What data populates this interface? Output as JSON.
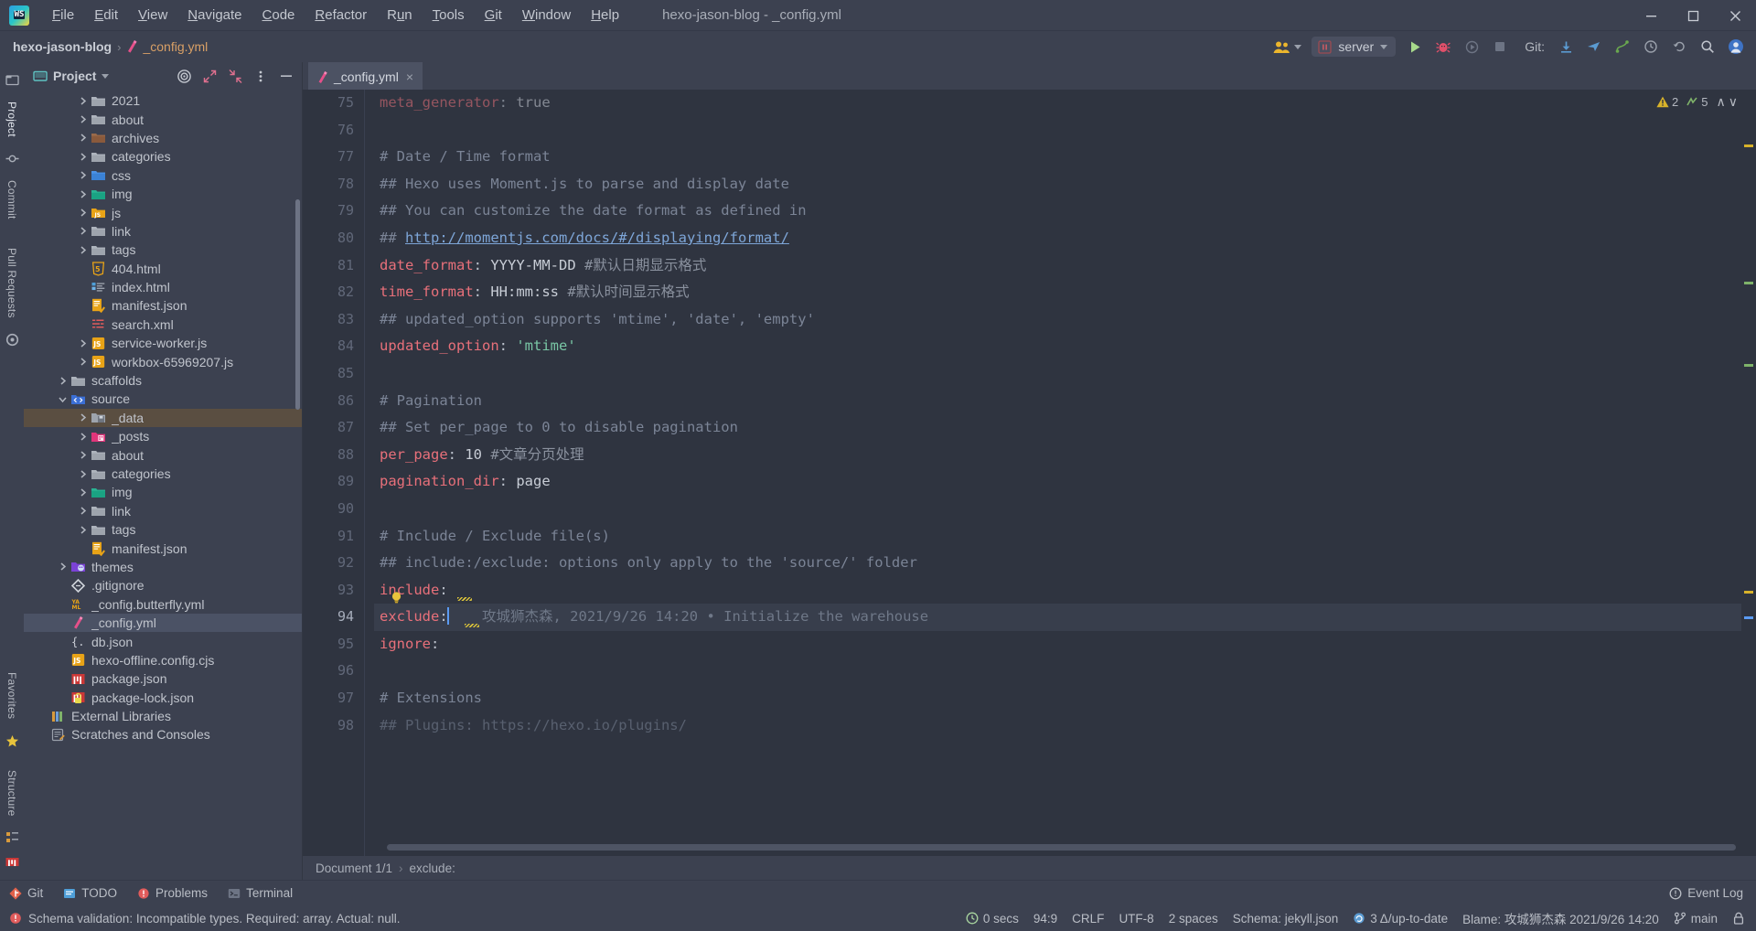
{
  "window": {
    "title": "hexo-jason-blog - _config.yml",
    "minimize_label": "—",
    "maximize_label": "❐",
    "close_label": "✕"
  },
  "menu": {
    "items": [
      {
        "label": "File",
        "mnemonic": "F"
      },
      {
        "label": "Edit",
        "mnemonic": "E"
      },
      {
        "label": "View",
        "mnemonic": "V"
      },
      {
        "label": "Navigate",
        "mnemonic": "N"
      },
      {
        "label": "Code",
        "mnemonic": "C"
      },
      {
        "label": "Refactor",
        "mnemonic": "R"
      },
      {
        "label": "Run",
        "mnemonic": "u"
      },
      {
        "label": "Tools",
        "mnemonic": "T"
      },
      {
        "label": "Git",
        "mnemonic": "G"
      },
      {
        "label": "Window",
        "mnemonic": "W"
      },
      {
        "label": "Help",
        "mnemonic": "H"
      }
    ]
  },
  "navbar": {
    "project_name": "hexo-jason-blog",
    "separator": "›",
    "file_name": "_config.yml",
    "run_config": "server",
    "git_label": "Git:",
    "icons": {
      "collab": "collab-users-icon",
      "run": "run-icon",
      "debug": "debug-icon",
      "run_with_coverage": "run-with-coverage-icon",
      "stop": "stop-icon",
      "update_project": "update-project-icon",
      "push": "push-icon",
      "branches": "git-branches-icon",
      "history": "history-icon",
      "rollback": "rollback-icon",
      "search": "search-everywhere-icon",
      "account": "account-icon"
    }
  },
  "left_strip": {
    "top": [
      "Project",
      "Commit",
      "Pull Requests"
    ],
    "bottom": [
      "Structure",
      "Favorites"
    ]
  },
  "project_panel": {
    "title": "Project",
    "tree": [
      {
        "label": "2021",
        "indent": 2,
        "arrow": "right",
        "icon": "folder",
        "clipped": true
      },
      {
        "label": "about",
        "indent": 2,
        "arrow": "right",
        "icon": "folder"
      },
      {
        "label": "archives",
        "indent": 2,
        "arrow": "right",
        "icon": "folder-archive"
      },
      {
        "label": "categories",
        "indent": 2,
        "arrow": "right",
        "icon": "folder"
      },
      {
        "label": "css",
        "indent": 2,
        "arrow": "right",
        "icon": "folder-css"
      },
      {
        "label": "img",
        "indent": 2,
        "arrow": "right",
        "icon": "folder-img"
      },
      {
        "label": "js",
        "indent": 2,
        "arrow": "right",
        "icon": "folder-js"
      },
      {
        "label": "link",
        "indent": 2,
        "arrow": "right",
        "icon": "folder"
      },
      {
        "label": "tags",
        "indent": 2,
        "arrow": "right",
        "icon": "folder"
      },
      {
        "label": "404.html",
        "indent": 2,
        "arrow": "none",
        "icon": "html5"
      },
      {
        "label": "index.html",
        "indent": 2,
        "arrow": "none",
        "icon": "html"
      },
      {
        "label": "manifest.json",
        "indent": 2,
        "arrow": "none",
        "icon": "json"
      },
      {
        "label": "search.xml",
        "indent": 2,
        "arrow": "none",
        "icon": "xml"
      },
      {
        "label": "service-worker.js",
        "indent": 2,
        "arrow": "right",
        "icon": "js"
      },
      {
        "label": "workbox-65969207.js",
        "indent": 2,
        "arrow": "right",
        "icon": "js"
      },
      {
        "label": "scaffolds",
        "indent": 1,
        "arrow": "right",
        "icon": "folder"
      },
      {
        "label": "source",
        "indent": 1,
        "arrow": "down",
        "icon": "folder-source"
      },
      {
        "label": "_data",
        "indent": 2,
        "arrow": "right",
        "icon": "folder-data",
        "state": "hl"
      },
      {
        "label": "_posts",
        "indent": 2,
        "arrow": "right",
        "icon": "folder-posts"
      },
      {
        "label": "about",
        "indent": 2,
        "arrow": "right",
        "icon": "folder"
      },
      {
        "label": "categories",
        "indent": 2,
        "arrow": "right",
        "icon": "folder"
      },
      {
        "label": "img",
        "indent": 2,
        "arrow": "right",
        "icon": "folder-img"
      },
      {
        "label": "link",
        "indent": 2,
        "arrow": "right",
        "icon": "folder"
      },
      {
        "label": "tags",
        "indent": 2,
        "arrow": "right",
        "icon": "folder"
      },
      {
        "label": "manifest.json",
        "indent": 2,
        "arrow": "none",
        "icon": "json"
      },
      {
        "label": "themes",
        "indent": 1,
        "arrow": "right",
        "icon": "folder-themes"
      },
      {
        "label": ".gitignore",
        "indent": 1,
        "arrow": "none",
        "icon": "git"
      },
      {
        "label": "_config.butterfly.yml",
        "indent": 1,
        "arrow": "none",
        "icon": "yaml"
      },
      {
        "label": "_config.yml",
        "indent": 1,
        "arrow": "none",
        "icon": "yml-pink",
        "state": "sel"
      },
      {
        "label": "db.json",
        "indent": 1,
        "arrow": "none",
        "icon": "json-brace"
      },
      {
        "label": "hexo-offline.config.cjs",
        "indent": 1,
        "arrow": "none",
        "icon": "js"
      },
      {
        "label": "package.json",
        "indent": 1,
        "arrow": "none",
        "icon": "npm"
      },
      {
        "label": "package-lock.json",
        "indent": 1,
        "arrow": "none",
        "icon": "npm-lock"
      },
      {
        "label": "External Libraries",
        "indent": 0,
        "arrow": "none",
        "icon": "libraries"
      },
      {
        "label": "Scratches and Consoles",
        "indent": 0,
        "arrow": "none",
        "icon": "scratches"
      }
    ]
  },
  "editor": {
    "tab": {
      "label": "_config.yml",
      "close": "×",
      "icon": "yml-pink-icon"
    },
    "first_line_number": 75,
    "lines": [
      {
        "n": 75,
        "clipped": true,
        "tokens": [
          {
            "t": "meta_generator",
            "c": "key"
          },
          {
            "t": ": ",
            "c": "plain"
          },
          {
            "t": "true",
            "c": "val"
          }
        ]
      },
      {
        "n": 76,
        "tokens": []
      },
      {
        "n": 77,
        "tokens": [
          {
            "t": "# Date / Time format",
            "c": "com"
          }
        ]
      },
      {
        "n": 78,
        "tokens": [
          {
            "t": "## Hexo uses Moment.js to parse and display date",
            "c": "com"
          }
        ]
      },
      {
        "n": 79,
        "tokens": [
          {
            "t": "## You can customize the date format as defined in",
            "c": "com"
          }
        ]
      },
      {
        "n": 80,
        "tokens": [
          {
            "t": "## ",
            "c": "com"
          },
          {
            "t": "http://momentjs.com/docs/#/displaying/format/",
            "c": "link"
          }
        ]
      },
      {
        "n": 81,
        "tokens": [
          {
            "t": "date_format",
            "c": "key"
          },
          {
            "t": ": ",
            "c": "plain"
          },
          {
            "t": "YYYY-MM-DD ",
            "c": "val"
          },
          {
            "t": "#默认日期显示格式",
            "c": "cn"
          }
        ]
      },
      {
        "n": 82,
        "tokens": [
          {
            "t": "time_format",
            "c": "key"
          },
          {
            "t": ": ",
            "c": "plain"
          },
          {
            "t": "HH:mm:ss ",
            "c": "val"
          },
          {
            "t": "#默认时间显示格式",
            "c": "cn"
          }
        ]
      },
      {
        "n": 83,
        "tokens": [
          {
            "t": "## updated_option supports 'mtime', 'date', 'empty'",
            "c": "com"
          }
        ]
      },
      {
        "n": 84,
        "tokens": [
          {
            "t": "updated_option",
            "c": "key"
          },
          {
            "t": ": ",
            "c": "plain"
          },
          {
            "t": "'mtime'",
            "c": "str"
          }
        ]
      },
      {
        "n": 85,
        "tokens": []
      },
      {
        "n": 86,
        "tokens": [
          {
            "t": "# Pagination",
            "c": "com"
          }
        ]
      },
      {
        "n": 87,
        "tokens": [
          {
            "t": "## Set per_page to 0 to disable pagination",
            "c": "com"
          }
        ]
      },
      {
        "n": 88,
        "tokens": [
          {
            "t": "per_page",
            "c": "key"
          },
          {
            "t": ": ",
            "c": "plain"
          },
          {
            "t": "10 ",
            "c": "num"
          },
          {
            "t": "#文章分页处理",
            "c": "cn"
          }
        ]
      },
      {
        "n": 89,
        "tokens": [
          {
            "t": "pagination_dir",
            "c": "key"
          },
          {
            "t": ": ",
            "c": "plain"
          },
          {
            "t": "page",
            "c": "val"
          }
        ]
      },
      {
        "n": 90,
        "tokens": []
      },
      {
        "n": 91,
        "tokens": [
          {
            "t": "# Include / Exclude file(s)",
            "c": "com"
          }
        ]
      },
      {
        "n": 92,
        "tokens": [
          {
            "t": "## include:/exclude: options only apply to the 'source/' folder",
            "c": "com"
          }
        ]
      },
      {
        "n": 93,
        "tokens": [
          {
            "t": "include",
            "c": "key"
          },
          {
            "t": ":",
            "c": "plain"
          }
        ]
      },
      {
        "n": 94,
        "current": true,
        "tokens": [
          {
            "t": "exclude",
            "c": "key"
          },
          {
            "t": ":",
            "c": "plain"
          },
          {
            "t": "CARET",
            "c": "caret"
          },
          {
            "t": "    攻城狮杰森, 2021/9/26 14:20 • Initialize the warehouse",
            "c": "blame"
          }
        ]
      },
      {
        "n": 95,
        "tokens": [
          {
            "t": "ignore",
            "c": "key"
          },
          {
            "t": ":",
            "c": "plain"
          }
        ]
      },
      {
        "n": 96,
        "tokens": []
      },
      {
        "n": 97,
        "tokens": [
          {
            "t": "# Extensions",
            "c": "com"
          }
        ]
      },
      {
        "n": 98,
        "clipped": true,
        "tokens": [
          {
            "t": "## Plugins: https://hexo.io/plugins/",
            "c": "com"
          }
        ]
      }
    ],
    "inspection": {
      "warnings": "2",
      "weak_warnings": "5",
      "up_arrow": "∧",
      "down_arrow": "∨",
      "warning_icon": "warning-triangle-icon",
      "weak_warning_icon": "weak-warning-icon"
    },
    "breadcrumbs": [
      "Document 1/1",
      "exclude:"
    ]
  },
  "bottom_bar": {
    "items": [
      {
        "label": "Git",
        "icon": "git-icon"
      },
      {
        "label": "TODO",
        "icon": "todo-icon"
      },
      {
        "label": "Problems",
        "icon": "problems-icon"
      },
      {
        "label": "Terminal",
        "icon": "terminal-icon"
      }
    ],
    "right": {
      "label": "Event Log",
      "icon": "event-log-icon"
    }
  },
  "status_bar": {
    "message": "Schema validation: Incompatible types. Required: array. Actual: null.",
    "message_icon": "error-icon",
    "items": [
      {
        "label": "0 secs",
        "icon": "clock-icon",
        "name": "build-time"
      },
      {
        "label": "94:9",
        "name": "caret-position"
      },
      {
        "label": "CRLF",
        "name": "line-separator"
      },
      {
        "label": "UTF-8",
        "name": "file-encoding"
      },
      {
        "label": "2 spaces",
        "name": "indent"
      },
      {
        "label": "Schema: jekyll.json",
        "name": "json-schema"
      },
      {
        "label": "3 Δ/up-to-date",
        "icon": "sync-icon",
        "name": "sync-status"
      },
      {
        "label": "Blame: 攻城狮杰森 2021/9/26 14:20",
        "name": "blame-status"
      },
      {
        "label": "main",
        "icon": "branch-icon",
        "name": "git-branch"
      },
      {
        "label": "",
        "icon": "lock-icon",
        "name": "read-only-toggle"
      }
    ]
  },
  "colors": {
    "chrome": "#3c4150",
    "editor": "#2f3440",
    "accent": "#6b9bd2",
    "key": "#e8707a",
    "comment": "#7b8496",
    "string": "#79c6a5",
    "link": "#7ea6d8",
    "error": "#e05b5b",
    "warning": "#d8b22a",
    "run_green": "#a7d98b",
    "debug_red": "#e0506a"
  }
}
